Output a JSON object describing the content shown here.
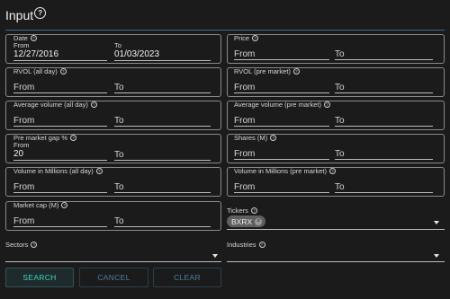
{
  "header": {
    "title": "Input",
    "help_glyph": "?"
  },
  "help_glyph": "?",
  "common": {
    "from": "From",
    "to": "To"
  },
  "fields": {
    "date": {
      "label": "Date",
      "from_label": "From",
      "to_label": "To",
      "from_value": "12/27/2016",
      "to_value": "01/03/2023"
    },
    "price": {
      "label": "Price"
    },
    "rvol_all": {
      "label": "RVOL (all day)"
    },
    "rvol_pre": {
      "label": "RVOL (pre market)"
    },
    "avgvol_all": {
      "label": "Average volume (all day)"
    },
    "avgvol_pre": {
      "label": "Average volume (pre market)"
    },
    "gap": {
      "label": "Pre market gap %",
      "from_label": "From",
      "from_value": "20"
    },
    "shares": {
      "label": "Shares (M)"
    },
    "volmil_all": {
      "label": "Volume in Millions (all day)"
    },
    "volmil_pre": {
      "label": "Volume in Millions (pre market)"
    },
    "mcap": {
      "label": "Market cap (M)"
    },
    "tickers": {
      "label": "Tickers",
      "chips": [
        "BXRX"
      ]
    },
    "sectors": {
      "label": "Sectors",
      "value": ""
    },
    "industries": {
      "label": "Industries",
      "value": ""
    }
  },
  "buttons": {
    "search": "SEARCH",
    "cancel": "CANCEL",
    "clear": "CLEAR"
  },
  "colors": {
    "accent": "#3fd8c6",
    "secondary_button_text": "#4d7fa0",
    "divider": "#3c6a87",
    "background": "#1b1b1b"
  }
}
